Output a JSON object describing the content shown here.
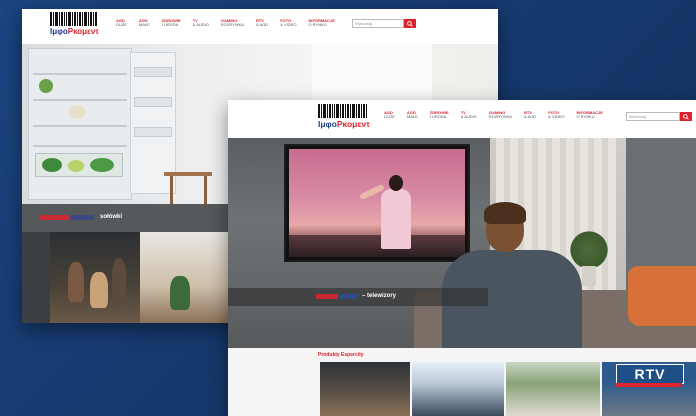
{
  "brand": {
    "logo_part1": "Ιμφο",
    "logo_part2": "Ρκομεντ",
    "logo_alt": "InfoProduct"
  },
  "colors": {
    "accent": "#d9232d",
    "brand_blue": "#1a3d8f",
    "background": "#163a6e"
  },
  "nav": [
    {
      "label": "AGD",
      "sub": "duże"
    },
    {
      "label": "AGD",
      "sub": "małe"
    },
    {
      "label": "Zdrowie",
      "sub": "i uroda"
    },
    {
      "label": "TV",
      "sub": "& audio"
    },
    {
      "label": "Gaming",
      "sub": "rozrywka"
    },
    {
      "label": "RTV",
      "sub": "& AGD"
    },
    {
      "label": "Foto",
      "sub": "& video"
    },
    {
      "label": "Informacje",
      "sub": "o rynku"
    }
  ],
  "search": {
    "placeholder": "Wyszukaj"
  },
  "back_page": {
    "banner_label": "sołówki"
  },
  "front_page": {
    "hero_caption": "– telewizory",
    "offers_title": "Produkty Expercity",
    "rtv_badge": "RTV"
  }
}
